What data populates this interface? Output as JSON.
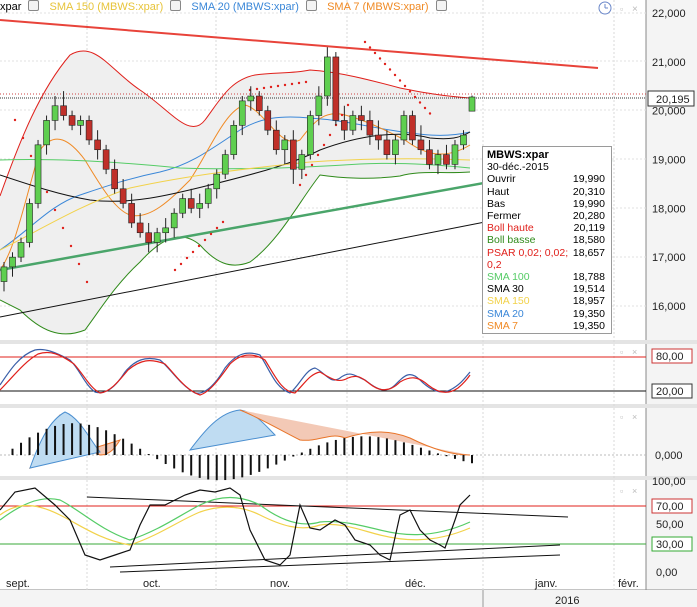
{
  "legend": [
    {
      "label": "xpar",
      "color": "#000000"
    },
    {
      "label": "SMA 150 (MBWS:xpar)",
      "color": "#f2d24a"
    },
    {
      "label": "SMA 20 (MBWS:xpar)",
      "color": "#3a87d8"
    },
    {
      "label": "SMA 7 (MBWS:xpar)",
      "color": "#f08a24"
    }
  ],
  "price_axis": {
    "ticks": [
      "22,000",
      "21,000",
      "20,000",
      "19,000",
      "18,000",
      "17,000",
      "16,000"
    ],
    "current": "20,195"
  },
  "osc1_axis": {
    "labels": [
      "80,00",
      "20,00"
    ]
  },
  "osc2_axis": {
    "labels": [
      "0,000"
    ]
  },
  "osc3_axis": {
    "labels": [
      "100,00",
      "70,00",
      "50,00",
      "30,00",
      "0,00"
    ]
  },
  "time_axis": {
    "labels": [
      "sept.",
      "oct.",
      "nov.",
      "déc.",
      "janv.",
      "févr."
    ],
    "year": "2016"
  },
  "infobox": {
    "title": "MBWS:xpar",
    "date": "30-déc.-2015",
    "rows": [
      {
        "label": "Ouvrir",
        "value": "19,990",
        "color": "#000000"
      },
      {
        "label": "Haut",
        "value": "20,310",
        "color": "#000000"
      },
      {
        "label": "Bas",
        "value": "19,990",
        "color": "#000000"
      },
      {
        "label": "Fermer",
        "value": "20,280",
        "color": "#000000"
      },
      {
        "label": "Boll haute",
        "value": "20,119",
        "color": "#e0201b"
      },
      {
        "label": "Boll basse",
        "value": "18,580",
        "color": "#2f8a1a"
      },
      {
        "label": "PSAR 0,02; 0,02; 0,2",
        "value": "18,657",
        "color": "#e0201b"
      },
      {
        "label": "SMA 100",
        "value": "18,788",
        "color": "#55cc66"
      },
      {
        "label": "SMA 30",
        "value": "19,514",
        "color": "#000000"
      },
      {
        "label": "SMA 150",
        "value": "18,957",
        "color": "#f2d24a"
      },
      {
        "label": "SMA 20",
        "value": "19,350",
        "color": "#3a87d8"
      },
      {
        "label": "SMA 7",
        "value": "19,350",
        "color": "#f08a24"
      }
    ]
  },
  "chart_data": {
    "type": "candlestick",
    "title": "MBWS:xpar",
    "x_months": [
      "sept.",
      "oct.",
      "nov.",
      "déc.",
      "janv.",
      "févr."
    ],
    "ylim": [
      15.5,
      22.3
    ],
    "ohlc": [
      [
        16.5,
        16.9,
        16.3,
        16.8
      ],
      [
        16.8,
        17.1,
        16.6,
        17.0
      ],
      [
        17.0,
        17.4,
        16.9,
        17.3
      ],
      [
        17.3,
        18.2,
        17.2,
        18.1
      ],
      [
        18.1,
        19.4,
        18.0,
        19.3
      ],
      [
        19.3,
        19.9,
        19.1,
        19.8
      ],
      [
        19.8,
        20.3,
        19.6,
        20.1
      ],
      [
        20.1,
        20.4,
        19.8,
        19.9
      ],
      [
        19.9,
        20.0,
        19.6,
        19.7
      ],
      [
        19.7,
        19.9,
        19.5,
        19.8
      ],
      [
        19.8,
        19.9,
        19.3,
        19.4
      ],
      [
        19.4,
        19.6,
        19.0,
        19.2
      ],
      [
        19.2,
        19.3,
        18.7,
        18.8
      ],
      [
        18.8,
        19.0,
        18.3,
        18.4
      ],
      [
        18.4,
        18.6,
        18.0,
        18.1
      ],
      [
        18.1,
        18.3,
        17.6,
        17.7
      ],
      [
        17.7,
        17.9,
        17.4,
        17.5
      ],
      [
        17.5,
        17.7,
        17.1,
        17.3
      ],
      [
        17.3,
        17.6,
        17.1,
        17.5
      ],
      [
        17.5,
        17.8,
        17.3,
        17.6
      ],
      [
        17.6,
        18.0,
        17.4,
        17.9
      ],
      [
        17.9,
        18.3,
        17.8,
        18.2
      ],
      [
        18.2,
        18.4,
        17.9,
        18.0
      ],
      [
        18.0,
        18.3,
        17.8,
        18.1
      ],
      [
        18.1,
        18.5,
        18.0,
        18.4
      ],
      [
        18.4,
        18.8,
        18.2,
        18.7
      ],
      [
        18.7,
        19.2,
        18.6,
        19.1
      ],
      [
        19.1,
        19.8,
        19.0,
        19.7
      ],
      [
        19.7,
        20.3,
        19.5,
        20.2
      ],
      [
        20.2,
        20.5,
        20.0,
        20.3
      ],
      [
        20.3,
        20.4,
        19.9,
        20.0
      ],
      [
        20.0,
        20.1,
        19.5,
        19.6
      ],
      [
        19.6,
        19.8,
        19.1,
        19.2
      ],
      [
        19.2,
        19.5,
        18.9,
        19.4
      ],
      [
        19.4,
        19.6,
        18.5,
        18.8
      ],
      [
        18.8,
        19.2,
        18.6,
        19.1
      ],
      [
        19.1,
        20.0,
        19.0,
        19.9
      ],
      [
        19.9,
        20.5,
        19.7,
        20.3
      ],
      [
        20.3,
        21.3,
        20.1,
        21.1
      ],
      [
        21.1,
        21.2,
        19.7,
        19.8
      ],
      [
        19.8,
        20.1,
        19.4,
        19.6
      ],
      [
        19.6,
        20.0,
        19.5,
        19.9
      ],
      [
        19.9,
        20.1,
        19.6,
        19.8
      ],
      [
        19.8,
        20.0,
        19.3,
        19.5
      ],
      [
        19.5,
        19.8,
        19.2,
        19.4
      ],
      [
        19.4,
        19.6,
        19.0,
        19.1
      ],
      [
        19.1,
        19.5,
        18.9,
        19.4
      ],
      [
        19.4,
        20.0,
        19.3,
        19.9
      ],
      [
        19.9,
        20.0,
        19.3,
        19.4
      ],
      [
        19.4,
        19.7,
        19.1,
        19.2
      ],
      [
        19.2,
        19.4,
        18.8,
        18.9
      ],
      [
        18.9,
        19.2,
        18.7,
        19.1
      ],
      [
        19.1,
        19.3,
        18.8,
        18.9
      ],
      [
        18.9,
        19.4,
        18.8,
        19.3
      ],
      [
        19.3,
        19.6,
        19.2,
        19.5
      ],
      [
        19.99,
        20.31,
        19.99,
        20.28
      ]
    ],
    "lines": [
      {
        "name": "Boll haute",
        "value": 20.119
      },
      {
        "name": "Boll basse",
        "value": 18.58
      },
      {
        "name": "PSAR 0,02; 0,02; 0,2",
        "value": 18.657
      },
      {
        "name": "SMA 100",
        "value": 18.788
      },
      {
        "name": "SMA 30",
        "value": 19.514
      },
      {
        "name": "SMA 150",
        "value": 18.957
      },
      {
        "name": "SMA 20",
        "value": 19.35
      },
      {
        "name": "SMA 7",
        "value": 19.35
      }
    ],
    "last_close": 20.195
  }
}
